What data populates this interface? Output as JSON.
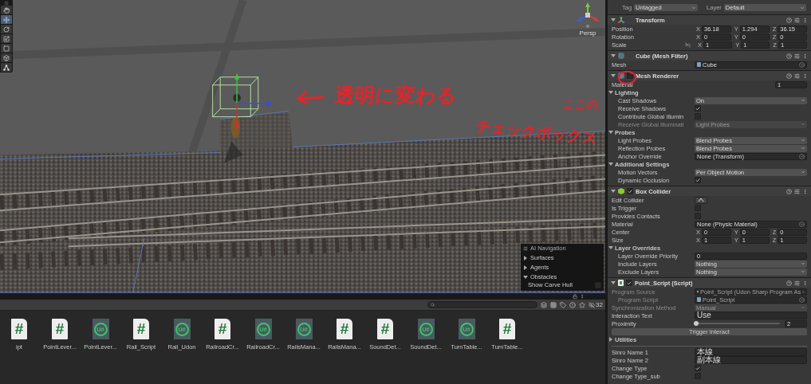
{
  "scene": {
    "tools": [
      {
        "kind": "hand",
        "selected": false
      },
      {
        "kind": "move",
        "selected": true
      },
      {
        "kind": "rotate",
        "selected": false
      },
      {
        "kind": "scale",
        "selected": false
      },
      {
        "kind": "rect",
        "selected": false
      },
      {
        "kind": "transform",
        "selected": false
      },
      {
        "kind": "custom",
        "selected": false
      }
    ],
    "gizmo_label": "Persp",
    "ai_navigation": {
      "title": "AI Navigation",
      "items": [
        {
          "label": "Surfaces",
          "expanded": false
        },
        {
          "label": "Agents",
          "expanded": false
        },
        {
          "label": "Obstacles",
          "expanded": true
        }
      ],
      "option": {
        "label": "Show Carve Hull",
        "checked": false
      }
    }
  },
  "annotations": {
    "scene_note": "透明に変わる",
    "side_note": [
      "ここの",
      "チェックボックス"
    ]
  },
  "project": {
    "count": "32",
    "assets": [
      {
        "kind": "cs",
        "glyph": "#",
        "label": "ipt"
      },
      {
        "kind": "cs",
        "glyph": "#",
        "label": "PointLever..."
      },
      {
        "kind": "udon",
        "glyph": "U#",
        "label": "PointLever..."
      },
      {
        "kind": "cs",
        "glyph": "#",
        "label": "Rail_Script"
      },
      {
        "kind": "udon",
        "glyph": "U#",
        "label": "Rail_Udon"
      },
      {
        "kind": "cs",
        "glyph": "#",
        "label": "RailroadCr..."
      },
      {
        "kind": "udon",
        "glyph": "U#",
        "label": "RailroadCr..."
      },
      {
        "kind": "udon",
        "glyph": "U#",
        "label": "RailsMana..."
      },
      {
        "kind": "cs",
        "glyph": "#",
        "label": "RailsMana..."
      },
      {
        "kind": "cs",
        "glyph": "#",
        "label": "SoundDet..."
      },
      {
        "kind": "udon",
        "glyph": "U#",
        "label": "SoundDet..."
      },
      {
        "kind": "udon",
        "glyph": "U#",
        "label": "TurnTable..."
      },
      {
        "kind": "cs",
        "glyph": "#",
        "label": "TurnTable..."
      }
    ]
  },
  "inspector": {
    "tag_label": "Tag",
    "tag": "Untagged",
    "layer_label": "Layer",
    "layer": "Default",
    "components": [
      {
        "title": "Transform",
        "kind": "transform",
        "rows": [
          {
            "kind": "vec3",
            "label": "Position",
            "fields": [
              {
                "axis": "X",
                "value": "36.18"
              },
              {
                "axis": "Y",
                "value": "1.294"
              },
              {
                "axis": "Z",
                "value": "36.15"
              }
            ]
          },
          {
            "kind": "vec3",
            "label": "Rotation",
            "fields": [
              {
                "axis": "X",
                "value": "0"
              },
              {
                "axis": "Y",
                "value": "0"
              },
              {
                "axis": "Z",
                "value": "0"
              }
            ]
          },
          {
            "kind": "vec3",
            "label": "Scale",
            "constrained": false,
            "fields": [
              {
                "axis": "X",
                "value": "1"
              },
              {
                "axis": "Y",
                "value": "1"
              },
              {
                "axis": "Z",
                "value": "1"
              }
            ]
          }
        ]
      },
      {
        "title": "Cube (Mesh Filter)",
        "kind": "filter",
        "rows": [
          {
            "kind": "object",
            "label": "Mesh",
            "value": "Cube",
            "asset_icon": true
          }
        ]
      },
      {
        "title": "Mesh Renderer",
        "kind": "renderer",
        "enabled": false,
        "rows": [
          {
            "kind": "number",
            "label": "Material",
            "value": "1",
            "narrow": true
          },
          {
            "kind": "foldout",
            "label": "Lighting",
            "expanded": true,
            "children": [
              {
                "kind": "dropdown",
                "label": "Cast Shadows",
                "value": "On",
                "disabled": false
              },
              {
                "kind": "check",
                "label": "Receive Shadows",
                "checked": true,
                "disabled": false
              },
              {
                "kind": "check",
                "label": "Contribute Global Illumin",
                "checked": false,
                "disabled": false
              },
              {
                "kind": "dropdown",
                "label": "Receive Global Illuminati",
                "value": "Light Probes",
                "disabled": true
              }
            ]
          },
          {
            "kind": "foldout",
            "label": "Probes",
            "expanded": true,
            "children": [
              {
                "kind": "dropdown",
                "label": "Light Probes",
                "value": "Blend Probes"
              },
              {
                "kind": "dropdown",
                "label": "Reflection Probes",
                "value": "Blend Probes"
              },
              {
                "kind": "object",
                "label": "Anchor Override",
                "value": "None (Transform)"
              }
            ]
          },
          {
            "kind": "foldout",
            "label": "Additional Settings",
            "expanded": true,
            "children": [
              {
                "kind": "dropdown",
                "label": "Motion Vectors",
                "value": "Per Object Motion"
              },
              {
                "kind": "check",
                "label": "Dynamic Occlusion",
                "checked": true
              }
            ]
          }
        ]
      },
      {
        "title": "Box Collider",
        "kind": "collider",
        "enabled": true,
        "rows": [
          {
            "kind": "tool",
            "label": "Edit Collider"
          },
          {
            "kind": "check",
            "label": "Is Trigger",
            "checked": false
          },
          {
            "kind": "check",
            "label": "Provides Contacts",
            "checked": false
          },
          {
            "kind": "object",
            "label": "Material",
            "value": "None (Physic Material)"
          },
          {
            "kind": "vec3",
            "label": "Center",
            "fields": [
              {
                "axis": "X",
                "value": "0"
              },
              {
                "axis": "Y",
                "value": "0"
              },
              {
                "axis": "Z",
                "value": "0"
              }
            ]
          },
          {
            "kind": "vec3",
            "label": "Size",
            "fields": [
              {
                "axis": "X",
                "value": "1"
              },
              {
                "axis": "Y",
                "value": "1"
              },
              {
                "axis": "Z",
                "value": "1"
              }
            ]
          },
          {
            "kind": "foldout",
            "label": "Layer Overrides",
            "expanded": true,
            "children": [
              {
                "kind": "number",
                "label": "Layer Override Priority",
                "value": "0"
              },
              {
                "kind": "dropdown",
                "label": "Include Layers",
                "value": "Nothing"
              },
              {
                "kind": "dropdown",
                "label": "Exclude Layers",
                "value": "Nothing"
              }
            ]
          }
        ]
      },
      {
        "title": "Point_Script (Script)",
        "kind": "script",
        "enabled": true,
        "rows": [
          {
            "kind": "object",
            "label": "Program Source",
            "value": "Point_Script (Udon Sharp Program As",
            "asset_icon": true,
            "disabled": true,
            "children": [
              {
                "kind": "object",
                "label": "Program Script",
                "value": "Point_Script",
                "asset_icon": true,
                "disabled": true
              }
            ]
          },
          {
            "kind": "dropdown",
            "label": "Synchronization Method",
            "value": "Manual",
            "disabled": true
          },
          {
            "kind": "text",
            "label": "Interaction Text",
            "value": "Use",
            "disabled": false
          },
          {
            "kind": "slider",
            "label": "Proximity",
            "level": 0.02,
            "reading": "2",
            "disabled": false
          },
          {
            "kind": "button",
            "label": "Trigger Interact",
            "disabled": false
          },
          {
            "kind": "foldout",
            "label": "Utilities",
            "expanded": false,
            "disabled": false
          },
          {
            "kind": "divider",
            "disabled": false
          },
          {
            "kind": "text",
            "label": "Sinro Name 1",
            "value": "本線",
            "disabled": false
          },
          {
            "kind": "text",
            "label": "Sinro Name 2",
            "value": "副本線",
            "disabled": false
          },
          {
            "kind": "check",
            "label": "Change Type",
            "checked": true,
            "disabled": false
          },
          {
            "kind": "check",
            "label": "Change Type_sub",
            "checked": false,
            "disabled": false
          }
        ]
      }
    ]
  }
}
